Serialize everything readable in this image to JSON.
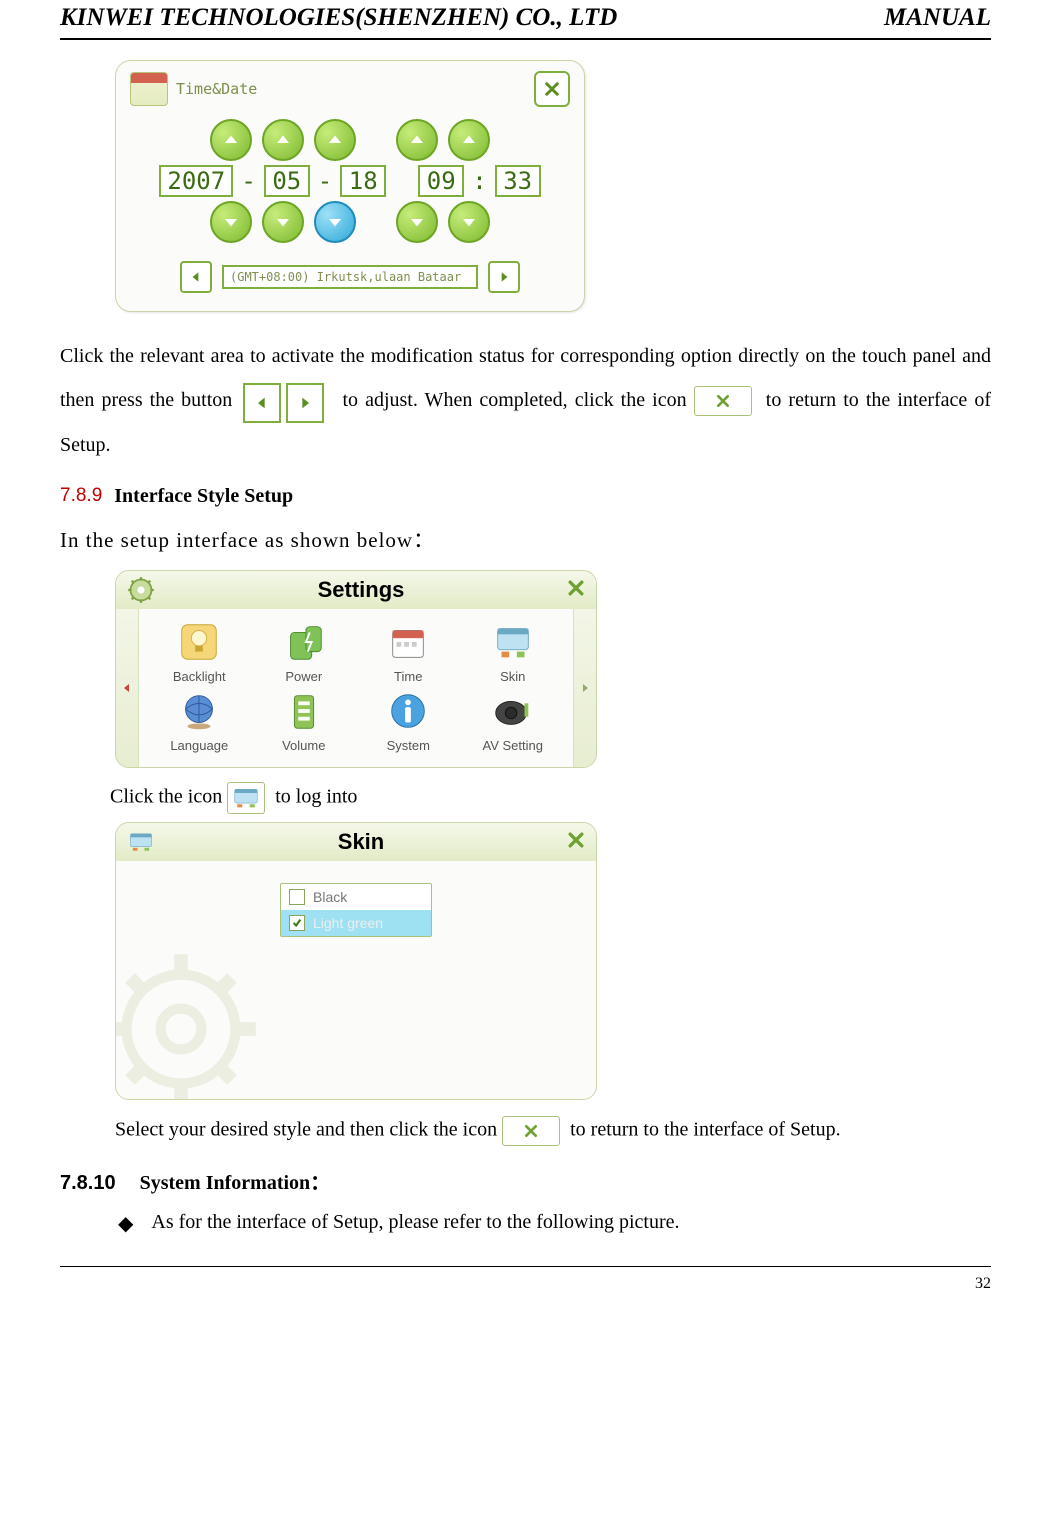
{
  "header": {
    "company": "KINWEI TECHNOLOGIES(SHENZHEN) CO., LTD",
    "manual": "MANUAL"
  },
  "time_date": {
    "title": "Time&Date",
    "year": "2007",
    "month": "05",
    "day": "18",
    "hour": "09",
    "minute": "33",
    "dash": "-",
    "colon": ":",
    "tz": "(GMT+08:00) Irkutsk,ulaan Bataar"
  },
  "para1": {
    "t1": "Click the relevant area to activate the modification status for corresponding option directly on the touch panel and then press the button",
    "t2": "to adjust. When completed, click the icon",
    "t3": "to return to the interface of Setup."
  },
  "section789": {
    "num": "7.8.9",
    "title": "Interface Style Setup",
    "intro": "In the setup interface as shown below："
  },
  "settings": {
    "title": "Settings",
    "items": [
      {
        "label": "Backlight"
      },
      {
        "label": "Power"
      },
      {
        "label": "Time"
      },
      {
        "label": "Skin"
      },
      {
        "label": "Language"
      },
      {
        "label": "Volume"
      },
      {
        "label": "System"
      },
      {
        "label": "AV Setting"
      }
    ]
  },
  "click_line": {
    "t1": "Click the icon",
    "t2": "to log into"
  },
  "skin": {
    "title": "Skin",
    "options": [
      {
        "label": "Black",
        "selected": false
      },
      {
        "label": "Light green",
        "selected": true
      }
    ]
  },
  "select_line": {
    "t1": "Select your desired style and then click the icon",
    "t2": "to return to the interface of Setup."
  },
  "section7810": {
    "num": "7.8.10",
    "title": "System Information："
  },
  "bullet": "As for the interface of Setup, please refer to the following picture.",
  "page_number": "32"
}
